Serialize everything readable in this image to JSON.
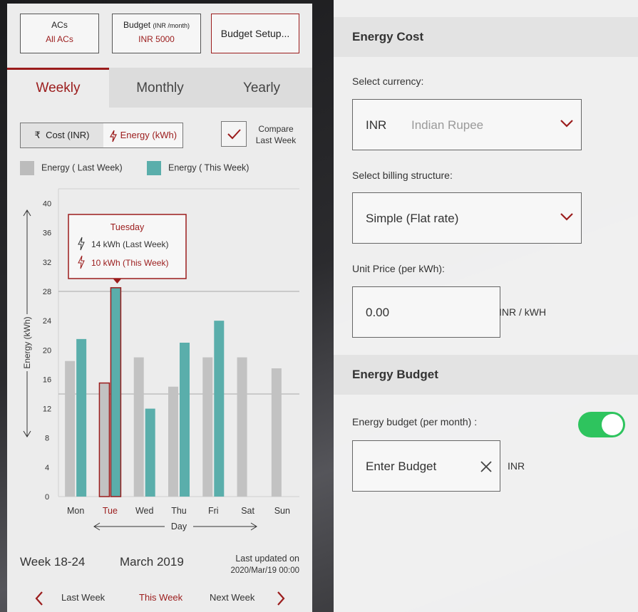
{
  "top_cards": {
    "acs": {
      "title": "ACs",
      "value": "All ACs"
    },
    "budget": {
      "title": "Budget",
      "title_small": "(INR /month)",
      "value": "INR 5000"
    },
    "setup_button": "Budget Setup..."
  },
  "tabs": [
    {
      "label": "Weekly",
      "active": true
    },
    {
      "label": "Monthly",
      "active": false
    },
    {
      "label": "Yearly",
      "active": false
    }
  ],
  "metric_toggle": {
    "cost": "Cost (INR)",
    "energy": "Energy (kWh)",
    "selected": "energy"
  },
  "compare": {
    "line1": "Compare",
    "line2": "Last Week",
    "checked": true
  },
  "legend": {
    "last_week": "Energy ( Last Week)",
    "this_week": "Energy ( This Week)"
  },
  "chart_data": {
    "type": "bar",
    "categories": [
      "Mon",
      "Tue",
      "Wed",
      "Thu",
      "Fri",
      "Sat",
      "Sun"
    ],
    "series": [
      {
        "name": "Energy ( Last Week)",
        "color": "#c2c2c2",
        "values": [
          18.5,
          15.5,
          19,
          15,
          19,
          19,
          17.5
        ]
      },
      {
        "name": "Energy ( This Week)",
        "color": "#5aaeab",
        "values": [
          21.5,
          28.5,
          12,
          21,
          24,
          null,
          null
        ]
      }
    ],
    "ylabel": "Energy (kWh)",
    "xlabel": "Day",
    "yticks": [
      0,
      4,
      8,
      12,
      16,
      20,
      24,
      28,
      32,
      36,
      40
    ],
    "ylim": [
      0,
      42
    ],
    "reference_lines": [
      28,
      14
    ],
    "selected_category": "Tue",
    "tooltip": {
      "title": "Tuesday",
      "last": "14  kWh (Last Week)",
      "this": "10  kWh (This Week)"
    }
  },
  "footer": {
    "week": "Week 18-24",
    "month": "March 2019",
    "updated_label": "Last updated on",
    "updated_value": "2020/Mar/19 00:00"
  },
  "nav": {
    "prev": "Last Week",
    "current": "This Week",
    "next": "Next Week"
  },
  "right": {
    "energy_cost_header": "Energy Cost",
    "currency_label": "Select currency:",
    "currency_code": "INR",
    "currency_name": "Indian Rupee",
    "billing_label": "Select billing structure:",
    "billing_value": "Simple (Flat rate)",
    "unit_price_label": "Unit Price (per kWh):",
    "unit_price_value": "0.00",
    "unit_price_unit": "INR / kWH",
    "energy_budget_header": "Energy Budget",
    "budget_toggle_label": "Energy budget (per month) :",
    "budget_toggle_on": true,
    "budget_placeholder": "Enter Budget",
    "budget_unit": "INR"
  },
  "colors": {
    "accent": "#9b1c1c",
    "teal": "#5aaeab",
    "grey_bar": "#c2c2c2",
    "switch_on": "#2ec45e"
  }
}
